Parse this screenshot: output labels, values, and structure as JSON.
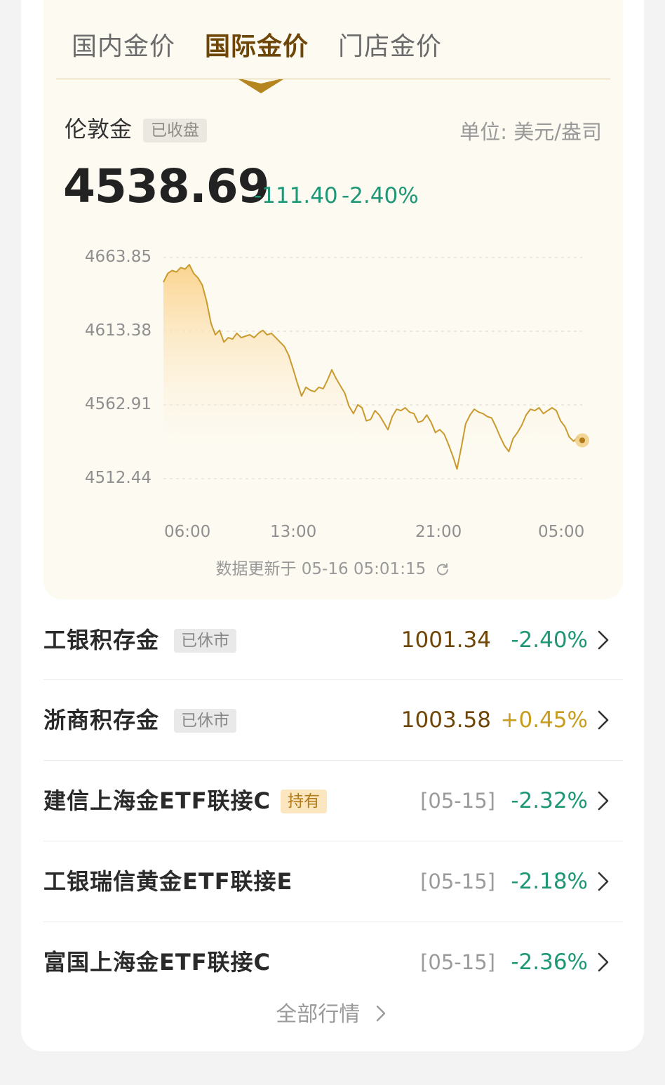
{
  "tabs": [
    {
      "label": "国内金价",
      "active": false
    },
    {
      "label": "国际金价",
      "active": true
    },
    {
      "label": "门店金价",
      "active": false
    }
  ],
  "instrument": {
    "name": "伦敦金",
    "status_badge": "已收盘",
    "unit": "单位: 美元/盎司",
    "price": "4538.69",
    "change": "-111.40",
    "change_pct": "-2.40%"
  },
  "chart_data": {
    "type": "area",
    "y_ticks": [
      "4663.85",
      "4613.38",
      "4562.91",
      "4512.44"
    ],
    "x_ticks": [
      "06:00",
      "13:00",
      "21:00",
      "05:00"
    ],
    "ylim": [
      4512.44,
      4663.85
    ],
    "grid": true,
    "legend": "none",
    "colors": {
      "line": "#c99a2e",
      "fill_top": "#fbd28a",
      "fill_bottom": "#fdfaf1"
    },
    "series": [
      {
        "values": [
          4647,
          4653,
          4655,
          4654,
          4657,
          4656,
          4659,
          4653,
          4650,
          4645,
          4634,
          4619,
          4611,
          4614,
          4606,
          4609,
          4608,
          4612,
          4609,
          4610,
          4611,
          4609,
          4612,
          4614,
          4611,
          4612,
          4609,
          4606,
          4603,
          4597,
          4588,
          4578,
          4569,
          4575,
          4573,
          4572,
          4575,
          4574,
          4580,
          4587,
          4581,
          4576,
          4571,
          4562,
          4557,
          4563,
          4561,
          4552,
          4553,
          4559,
          4556,
          4551,
          4546,
          4555,
          4560,
          4559,
          4561,
          4558,
          4557,
          4551,
          4552,
          4556,
          4551,
          4544,
          4546,
          4543,
          4536,
          4528,
          4519,
          4534,
          4550,
          4556,
          4560,
          4558,
          4557,
          4555,
          4554,
          4548,
          4541,
          4535,
          4531,
          4540,
          4544,
          4549,
          4556,
          4560,
          4559,
          4561,
          4557,
          4559,
          4561,
          4559,
          4552,
          4548,
          4541,
          4538,
          4541,
          4538.69
        ]
      }
    ]
  },
  "update_text": "数据更新于 05-16 05:01:15",
  "refresh_icon": "refresh-icon",
  "rows": [
    {
      "name": "工银积存金",
      "badge": "已休市",
      "badge_type": "closed",
      "value": "1001.34",
      "pct": "-2.40%",
      "dir": "down"
    },
    {
      "name": "浙商积存金",
      "badge": "已休市",
      "badge_type": "closed",
      "value": "1003.58",
      "pct": "+0.45%",
      "dir": "up"
    },
    {
      "name": "建信上海金ETF联接C",
      "badge": "持有",
      "badge_type": "hold",
      "date": "[05-15]",
      "pct": "-2.32%",
      "dir": "down"
    },
    {
      "name": "工银瑞信黄金ETF联接E",
      "badge": "",
      "date": "[05-15]",
      "pct": "-2.18%",
      "dir": "down"
    },
    {
      "name": "富国上海金ETF联接C",
      "badge": "",
      "date": "[05-15]",
      "pct": "-2.36%",
      "dir": "down"
    }
  ],
  "all_quotes": "全部行情"
}
